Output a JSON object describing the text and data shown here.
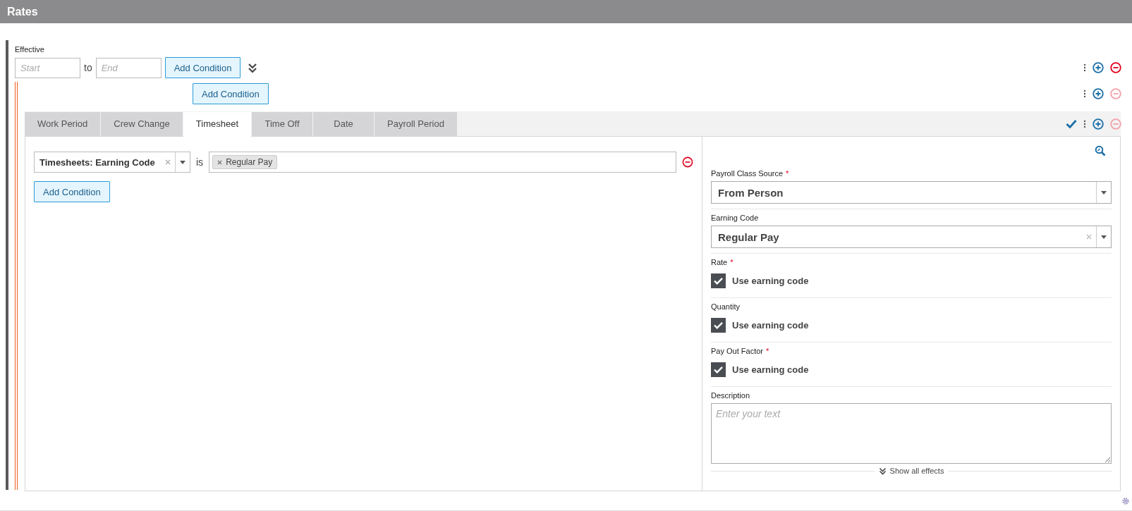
{
  "header": {
    "title": "Rates"
  },
  "effective": {
    "label": "Effective",
    "start": {
      "placeholder": "Start"
    },
    "to": "to",
    "end": {
      "placeholder": "End"
    },
    "add_button": "Add Condition",
    "remove_disabled": false
  },
  "group": {
    "add_button": "Add Condition",
    "remove_disabled": true
  },
  "tabs": [
    {
      "label": "Work Period",
      "selected": false
    },
    {
      "label": "Crew Change",
      "selected": false
    },
    {
      "label": "Timesheet",
      "selected": true
    },
    {
      "label": "Time Off",
      "selected": false
    },
    {
      "label": "Date",
      "selected": false
    },
    {
      "label": "Payroll Period",
      "selected": false
    }
  ],
  "tab_actions": {
    "confirmed": true,
    "remove_disabled": true
  },
  "condition": {
    "field": "Timesheets: Earning Code",
    "operator": "is",
    "values": [
      "Regular Pay"
    ]
  },
  "condition_add_button": "Add Condition",
  "effects": [
    {
      "kind": "select",
      "label": "Payroll Class Source",
      "required_mark": "*",
      "value": "From Person",
      "clearable": false
    },
    {
      "kind": "select",
      "label": "Earning Code",
      "value": "Regular Pay",
      "clearable": true
    },
    {
      "kind": "checkbox",
      "label": "Rate",
      "required_mark": "*",
      "text": "Use earning code",
      "checked": true
    },
    {
      "kind": "checkbox",
      "label": "Quantity",
      "text": "Use earning code",
      "checked": true
    },
    {
      "kind": "checkbox",
      "label": "Pay Out Factor",
      "required_mark": "*",
      "text": "Use earning code",
      "checked": true
    },
    {
      "kind": "textarea",
      "label": "Description",
      "placeholder": "Enter your text"
    }
  ],
  "show_all": "Show all effects"
}
